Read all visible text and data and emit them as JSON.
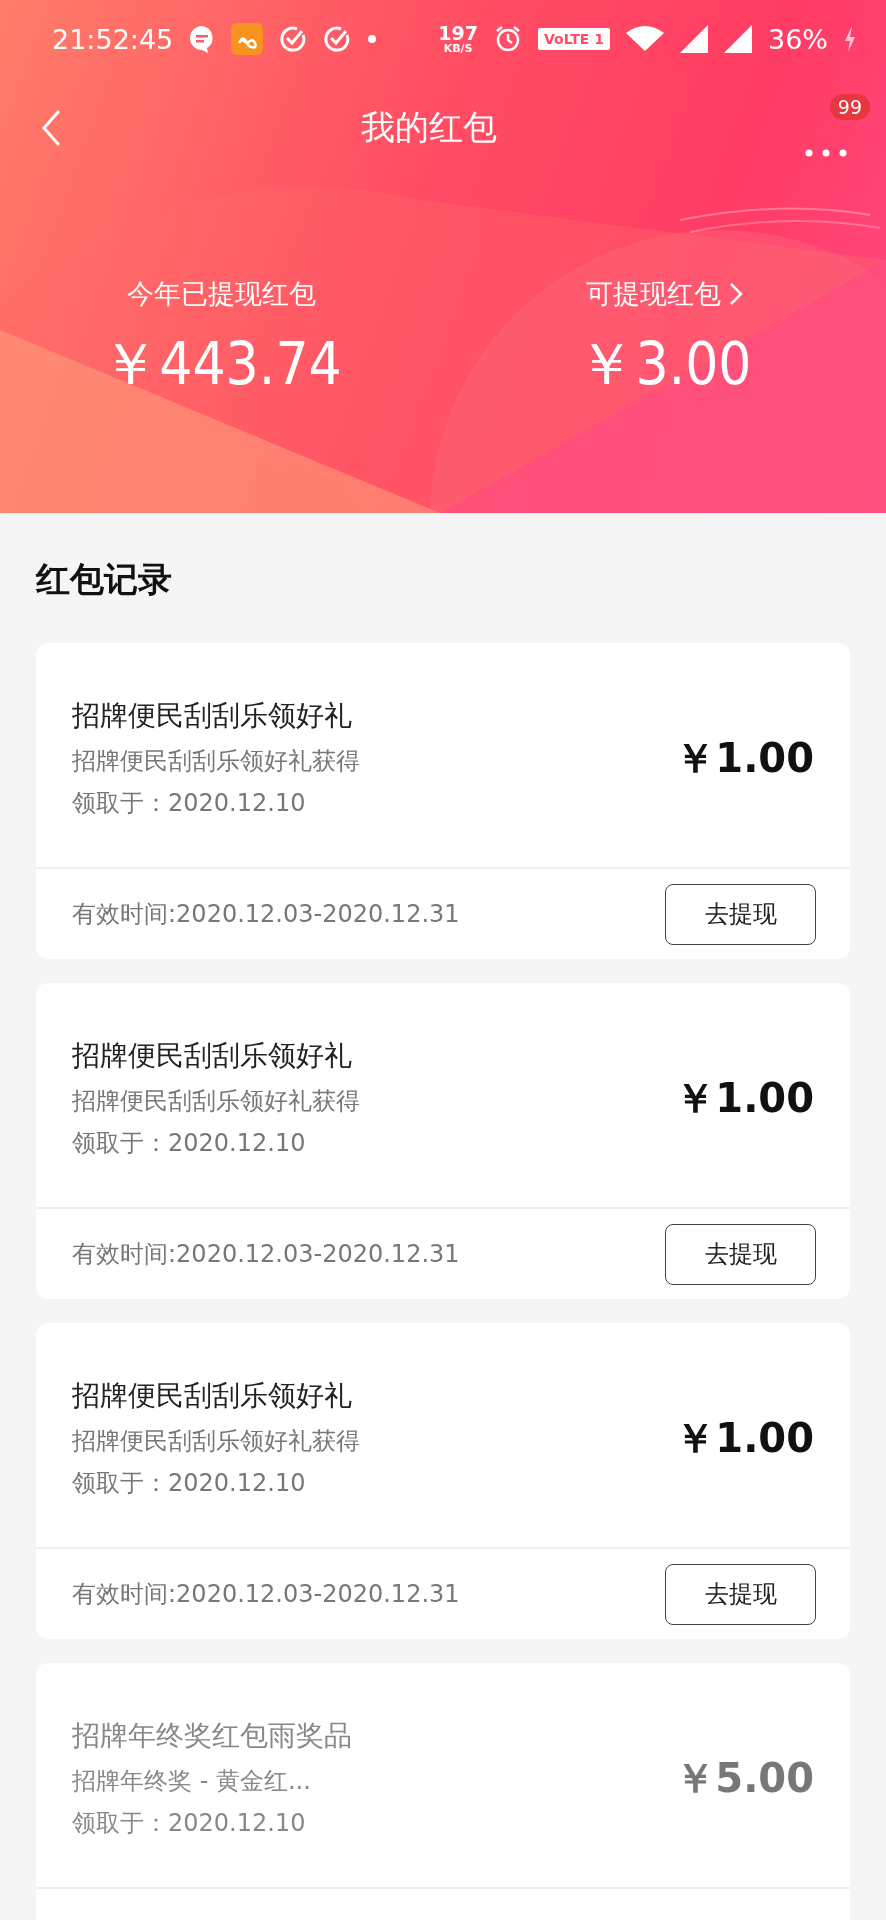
{
  "status_bar": {
    "time": "21:52:45",
    "speed": "197",
    "speed_unit": "KB/S",
    "network_badge": "VoLTE 1",
    "battery": "36%"
  },
  "header": {
    "title": "我的红包",
    "badge": "99"
  },
  "summary": [
    {
      "label": "今年已提现红包",
      "amount": "￥443.74",
      "link": false
    },
    {
      "label": "可提现红包",
      "amount": "￥3.00",
      "link": true
    }
  ],
  "section_title": "红包记录",
  "records": [
    {
      "title": "招牌便民刮刮乐领好礼",
      "subtitle": "招牌便民刮刮乐领好礼获得",
      "received": "领取于：2020.12.10",
      "amount": "￥1.00",
      "validity": "有效时间:2020.12.03-2020.12.31",
      "button": "去提现",
      "disabled": false
    },
    {
      "title": "招牌便民刮刮乐领好礼",
      "subtitle": "招牌便民刮刮乐领好礼获得",
      "received": "领取于：2020.12.10",
      "amount": "￥1.00",
      "validity": "有效时间:2020.12.03-2020.12.31",
      "button": "去提现",
      "disabled": false
    },
    {
      "title": "招牌便民刮刮乐领好礼",
      "subtitle": "招牌便民刮刮乐领好礼获得",
      "received": "领取于：2020.12.10",
      "amount": "￥1.00",
      "validity": "有效时间:2020.12.03-2020.12.31",
      "button": "去提现",
      "disabled": false
    },
    {
      "title": "招牌年终奖红包雨奖品",
      "subtitle": "招牌年终奖 - 黄金红...",
      "received": "领取于：2020.12.10",
      "amount": "￥5.00",
      "disabled": true
    }
  ]
}
